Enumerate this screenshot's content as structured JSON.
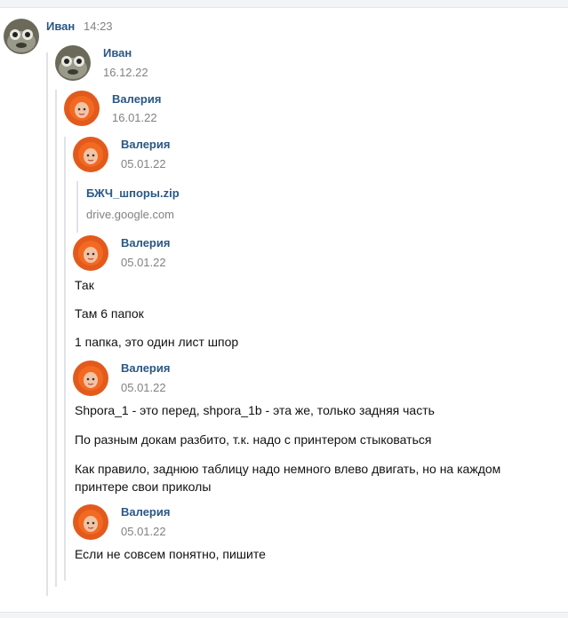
{
  "top_message": {
    "author": "Иван",
    "time": "14:23"
  },
  "forward_1": {
    "author": "Иван",
    "date": "16.12.22"
  },
  "forward_2": {
    "author": "Валерия",
    "date": "16.01.22"
  },
  "forward_3": {
    "author": "Валерия",
    "date": "05.01.22",
    "link": {
      "title": "БЖЧ_шпоры.zip",
      "domain": "drive.google.com"
    }
  },
  "message_a": {
    "author": "Валерия",
    "date": "05.01.22",
    "lines": [
      "Так",
      "Там 6 папок",
      "1 папка, это один лист шпор"
    ]
  },
  "message_b": {
    "author": "Валерия",
    "date": "05.01.22",
    "lines": [
      "Shpora_1 - это перед, shpora_1b - эта же, только задняя часть",
      "По разным докам разбито, т.к. надо с принтером стыковаться",
      "Как правило, заднюю таблицу надо немного влево двигать, но на каждом принтере свои приколы"
    ]
  },
  "message_c": {
    "author": "Валерия",
    "date": "05.01.22",
    "lines": [
      "Если не совсем понятно, пишите"
    ]
  },
  "colors": {
    "link": "#2a5885",
    "muted": "#828282",
    "thread_line": "#dfe3e8"
  }
}
